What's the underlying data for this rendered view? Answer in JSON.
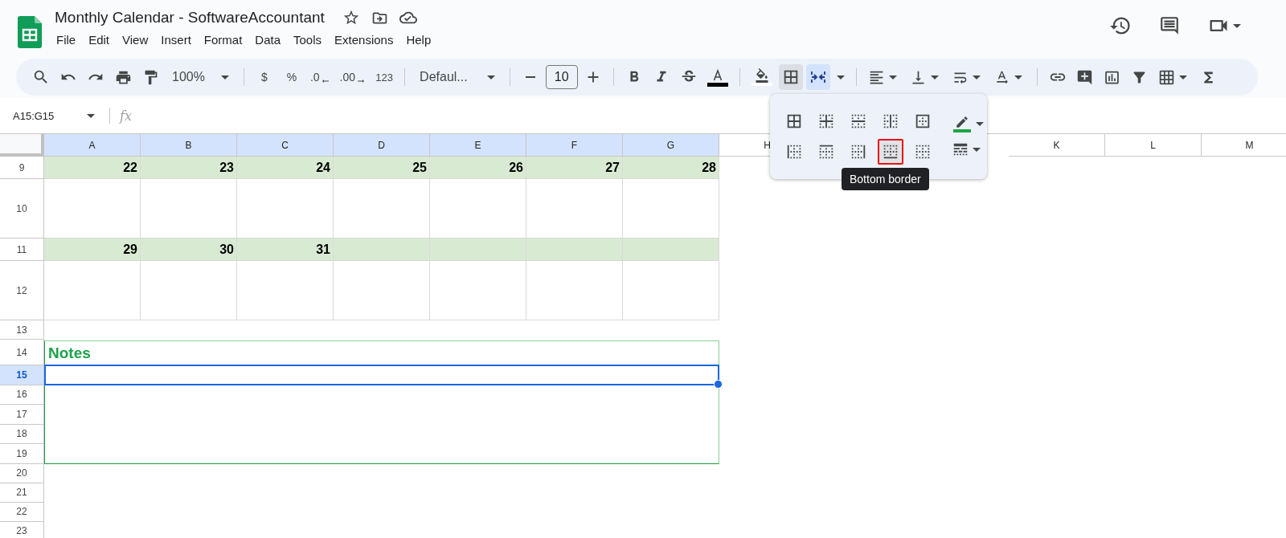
{
  "document": {
    "title": "Monthly Calendar - SoftwareAccountant"
  },
  "menu": [
    "File",
    "Edit",
    "View",
    "Insert",
    "Format",
    "Data",
    "Tools",
    "Extensions",
    "Help"
  ],
  "toolbar": {
    "zoom": "100%",
    "currency": "$",
    "percent": "%",
    "decrease_decimal": ".0",
    "increase_decimal": ".00",
    "number_format": "123",
    "font": "Defaul...",
    "font_size": "10",
    "borders_open": true,
    "merge_highlighted": true
  },
  "formula_bar": {
    "name_box": "A15:G15",
    "fx": "fx"
  },
  "borders_menu": {
    "options": [
      {
        "kind": "all",
        "selected": false
      },
      {
        "kind": "inner",
        "selected": false
      },
      {
        "kind": "horizontal",
        "selected": false
      },
      {
        "kind": "vertical",
        "selected": false
      },
      {
        "kind": "outer",
        "selected": false
      },
      {
        "kind": "left",
        "selected": false
      },
      {
        "kind": "top",
        "selected": false
      },
      {
        "kind": "right",
        "selected": false
      },
      {
        "kind": "bottom",
        "selected": true
      },
      {
        "kind": "clear",
        "selected": false
      }
    ],
    "tooltip": "Bottom border"
  },
  "sheet": {
    "columns": [
      {
        "label": "A",
        "selected": true
      },
      {
        "label": "B",
        "selected": true
      },
      {
        "label": "C",
        "selected": true
      },
      {
        "label": "D",
        "selected": true
      },
      {
        "label": "E",
        "selected": true
      },
      {
        "label": "F",
        "selected": true
      },
      {
        "label": "G",
        "selected": true
      },
      {
        "label": "H",
        "selected": false
      },
      {
        "label": "K",
        "selected": false
      },
      {
        "label": "L",
        "selected": false
      },
      {
        "label": "M",
        "selected": false
      }
    ],
    "rows": [
      {
        "number": "9",
        "kind": "date",
        "selected": false,
        "cells": [
          "22",
          "23",
          "24",
          "25",
          "26",
          "27",
          "28"
        ]
      },
      {
        "number": "10",
        "kind": "space",
        "selected": false
      },
      {
        "number": "11",
        "kind": "date",
        "selected": false,
        "cells": [
          "29",
          "30",
          "31"
        ]
      },
      {
        "number": "12",
        "kind": "space",
        "selected": false
      },
      {
        "number": "13",
        "kind": "gap",
        "selected": false
      },
      {
        "number": "14",
        "kind": "title",
        "selected": false,
        "text": "Notes"
      },
      {
        "number": "15",
        "kind": "note",
        "selected": true
      },
      {
        "number": "16",
        "kind": "note",
        "selected": false
      },
      {
        "number": "17",
        "kind": "note",
        "selected": false
      },
      {
        "number": "18",
        "kind": "note",
        "selected": false
      },
      {
        "number": "19",
        "kind": "note",
        "selected": false
      },
      {
        "number": "20",
        "kind": "gap",
        "selected": false
      },
      {
        "number": "21",
        "kind": "gap",
        "selected": false
      },
      {
        "number": "22",
        "kind": "gap",
        "selected": false
      },
      {
        "number": "23",
        "kind": "gap",
        "selected": false
      }
    ]
  }
}
